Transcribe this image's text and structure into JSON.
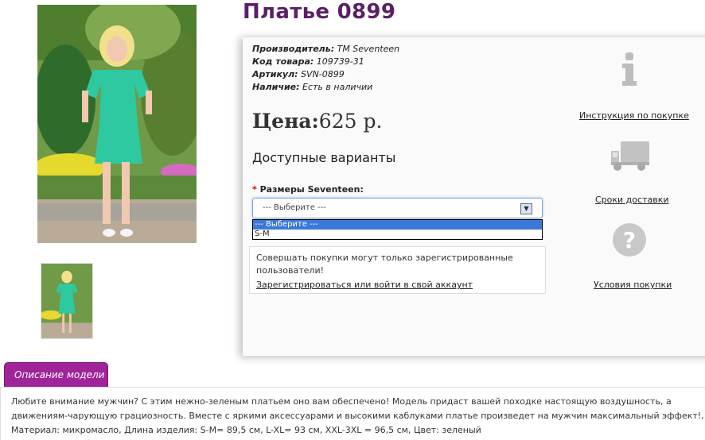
{
  "product": {
    "title": "Платье 0899",
    "specs": [
      {
        "label": "Производитель:",
        "value": "TM Seventeen"
      },
      {
        "label": "Код товара:",
        "value": "109739-31"
      },
      {
        "label": "Артикул:",
        "value": "SVN-0899"
      },
      {
        "label": "Наличие:",
        "value": "Есть в наличии"
      }
    ],
    "price_label": "Цена:",
    "price_value": "625 р."
  },
  "variants": {
    "heading": "Доступные варианты",
    "required_mark": "*",
    "size_label": "Размеры Seventeen:",
    "select_value": "--- Выберите ---",
    "options": [
      "--- Выберите ---",
      "S-M"
    ]
  },
  "notice": {
    "text": "Совершать покупки могут только зарегистрированные пользователи!",
    "link": "Зарегистрироваться или войти в свой аккаунт"
  },
  "side_links": {
    "instructions": "Инструкция по покупке",
    "delivery": "Сроки доставки",
    "terms": "Условия покупки"
  },
  "tab": {
    "label": "Описание модели"
  },
  "description": {
    "text": "Любите внимание мужчин? С этим нежно-зеленым платьем оно вам обеспечено! Модель придаст вашей походке настоящую воздушность, а движениям-чарующую грациозность. Вместе с яркими аксессуарами и высокими каблуками платье произведет на мужчин максимальный эффект!, Материал: микромасло, Длина изделия: S-M= 89,5 см, L-XL= 93 см, XXL-3XL = 96,5 см, Цвет: зеленый"
  },
  "colors": {
    "title": "#5a1f66",
    "tab": "#a0239a",
    "dress": "#2ec9a0"
  }
}
